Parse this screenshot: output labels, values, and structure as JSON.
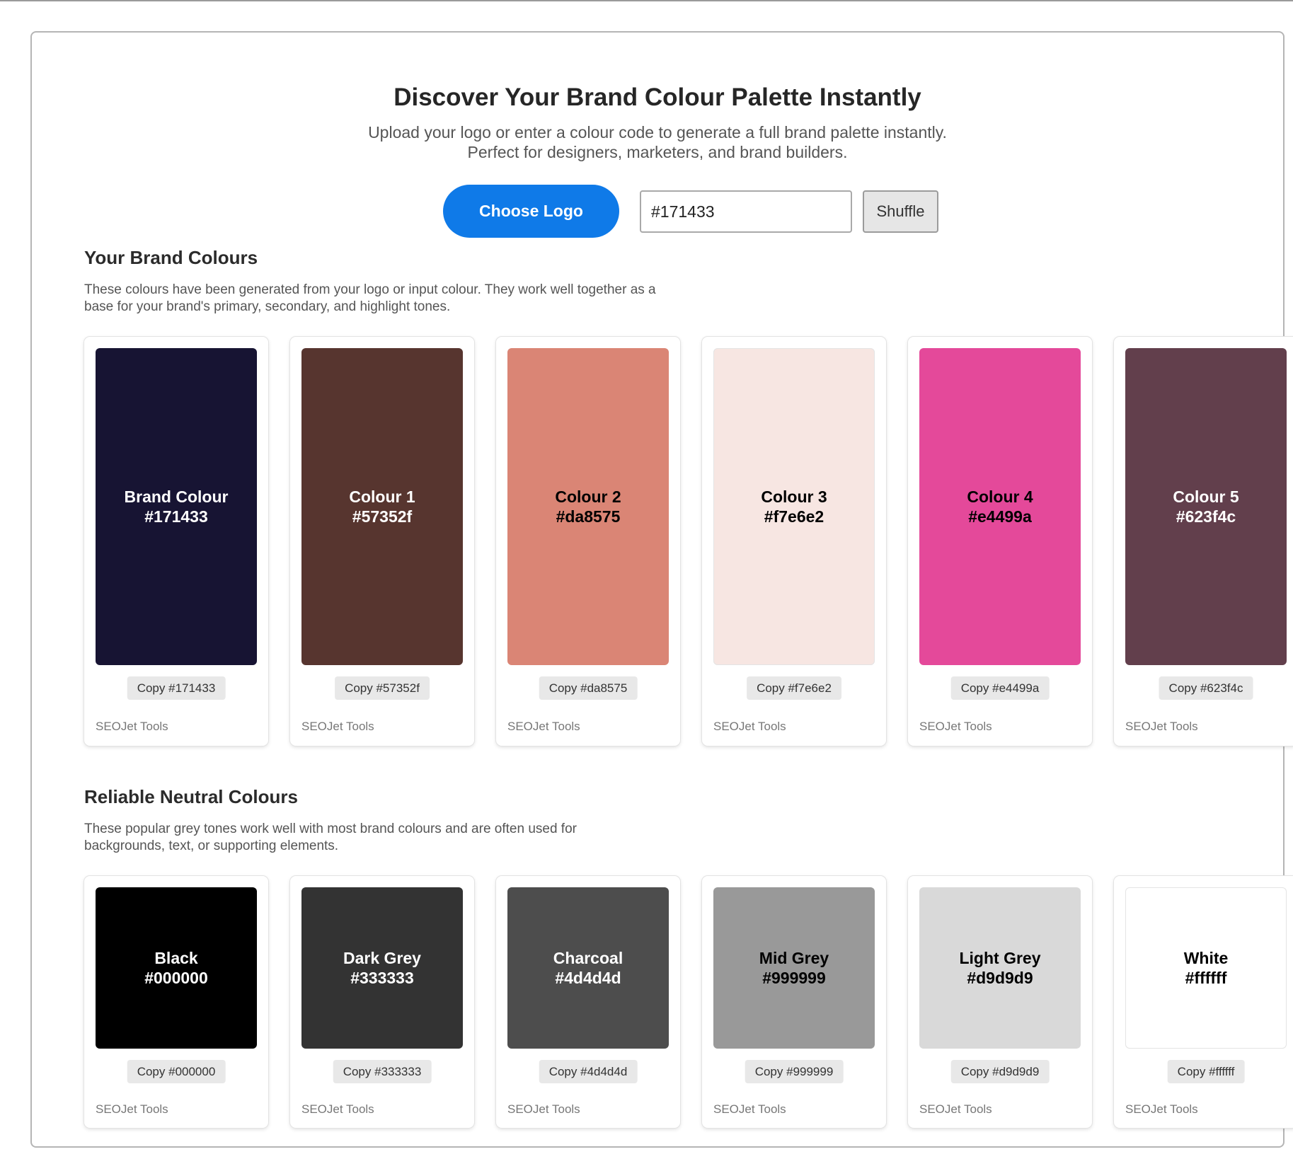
{
  "header": {
    "title": "Discover Your Brand Colour Palette Instantly",
    "subtitle_line1": "Upload your logo or enter a colour code to generate a full brand palette instantly.",
    "subtitle_line2": "Perfect for designers, marketers, and brand builders."
  },
  "controls": {
    "choose_logo_label": "Choose Logo",
    "colour_input_value": "#171433",
    "shuffle_label": "Shuffle"
  },
  "brand_section": {
    "title": "Your Brand Colours",
    "desc_line1": "These colours have been generated from your logo or input colour. They work well together as a",
    "desc_line2": "base for your brand's primary, secondary, and highlight tones.",
    "cards": [
      {
        "name": "Brand Colour",
        "hex": "#171433",
        "copy_label": "Copy #171433",
        "credit": "SEOJet Tools",
        "bg": "#171433",
        "text_color": "#ffffff"
      },
      {
        "name": "Colour 1",
        "hex": "#57352f",
        "copy_label": "Copy #57352f",
        "credit": "SEOJet Tools",
        "bg": "#57352f",
        "text_color": "#ffffff"
      },
      {
        "name": "Colour 2",
        "hex": "#da8575",
        "copy_label": "Copy #da8575",
        "credit": "SEOJet Tools",
        "bg": "#da8575",
        "text_color": "#000000"
      },
      {
        "name": "Colour 3",
        "hex": "#f7e6e2",
        "copy_label": "Copy #f7e6e2",
        "credit": "SEOJet Tools",
        "bg": "#f7e6e2",
        "text_color": "#000000"
      },
      {
        "name": "Colour 4",
        "hex": "#e4499a",
        "copy_label": "Copy #e4499a",
        "credit": "SEOJet Tools",
        "bg": "#e4499a",
        "text_color": "#000000"
      },
      {
        "name": "Colour 5",
        "hex": "#623f4c",
        "copy_label": "Copy #623f4c",
        "credit": "SEOJet Tools",
        "bg": "#623f4c",
        "text_color": "#ffffff"
      }
    ]
  },
  "neutral_section": {
    "title": "Reliable Neutral Colours",
    "desc_line1": "These popular grey tones work well with most brand colours and are often used for",
    "desc_line2": "backgrounds, text, or supporting elements.",
    "cards": [
      {
        "name": "Black",
        "hex": "#000000",
        "copy_label": "Copy #000000",
        "credit": "SEOJet Tools",
        "bg": "#000000",
        "text_color": "#ffffff"
      },
      {
        "name": "Dark Grey",
        "hex": "#333333",
        "copy_label": "Copy #333333",
        "credit": "SEOJet Tools",
        "bg": "#333333",
        "text_color": "#ffffff"
      },
      {
        "name": "Charcoal",
        "hex": "#4d4d4d",
        "copy_label": "Copy #4d4d4d",
        "credit": "SEOJet Tools",
        "bg": "#4d4d4d",
        "text_color": "#ffffff"
      },
      {
        "name": "Mid Grey",
        "hex": "#999999",
        "copy_label": "Copy #999999",
        "credit": "SEOJet Tools",
        "bg": "#999999",
        "text_color": "#000000"
      },
      {
        "name": "Light Grey",
        "hex": "#d9d9d9",
        "copy_label": "Copy #d9d9d9",
        "credit": "SEOJet Tools",
        "bg": "#d9d9d9",
        "text_color": "#000000"
      },
      {
        "name": "White",
        "hex": "#ffffff",
        "copy_label": "Copy #ffffff",
        "credit": "SEOJet Tools",
        "bg": "#ffffff",
        "text_color": "#000000"
      }
    ]
  }
}
